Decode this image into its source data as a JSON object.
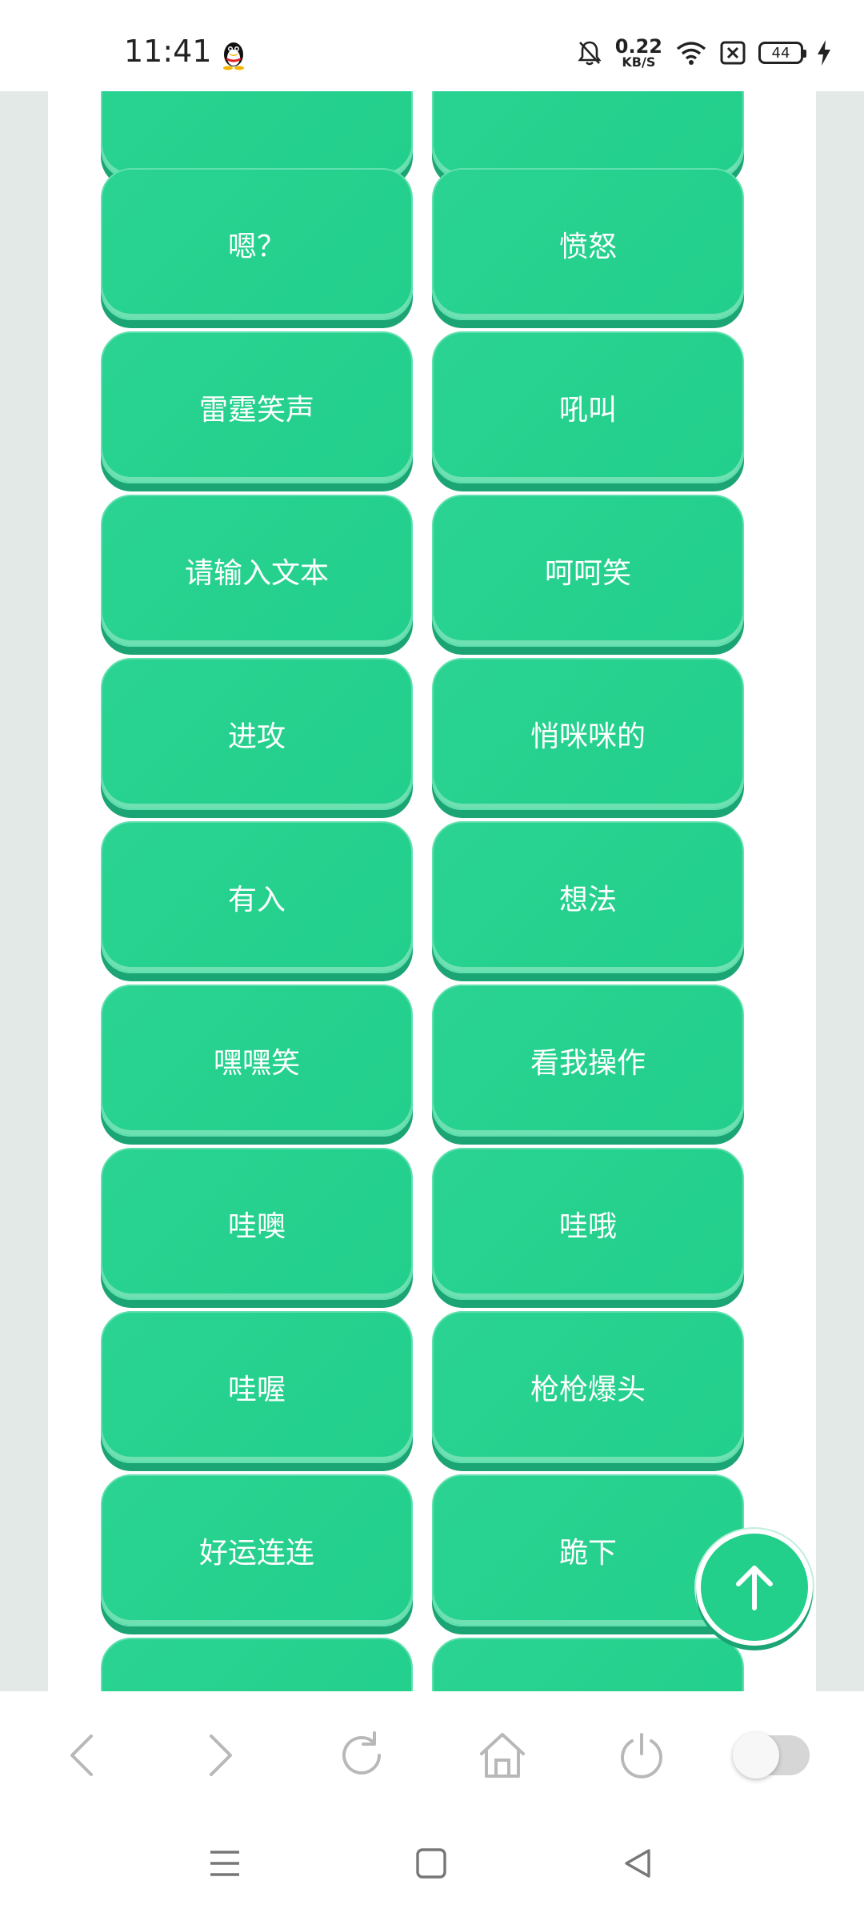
{
  "status_bar": {
    "time": "11:41",
    "net_speed_value": "0.22",
    "net_speed_unit": "KB/S",
    "battery": "44"
  },
  "buttons": [
    [
      "",
      ""
    ],
    [
      "嗯？",
      "愤怒"
    ],
    [
      "雷霆笑声",
      "吼叫"
    ],
    [
      "请输入文本",
      "呵呵笑"
    ],
    [
      "进攻",
      "悄咪咪的"
    ],
    [
      "有入",
      "想法"
    ],
    [
      "嘿嘿笑",
      "看我操作"
    ],
    [
      "哇噢",
      "哇哦"
    ],
    [
      "哇喔",
      "枪枪爆头"
    ],
    [
      "好运连连",
      "跪下"
    ],
    [
      "",
      ""
    ]
  ],
  "colors": {
    "button": "#22cf8b",
    "button_shadow": "#1ba574",
    "page_bg": "#e3e9e6"
  },
  "toolbar": {
    "icons": [
      "back-icon",
      "forward-icon",
      "refresh-icon",
      "home-icon",
      "power-icon"
    ],
    "toggle_on": false
  },
  "navbar": {
    "icons": [
      "menu-icon",
      "home-square-icon",
      "back-triangle-icon"
    ]
  }
}
